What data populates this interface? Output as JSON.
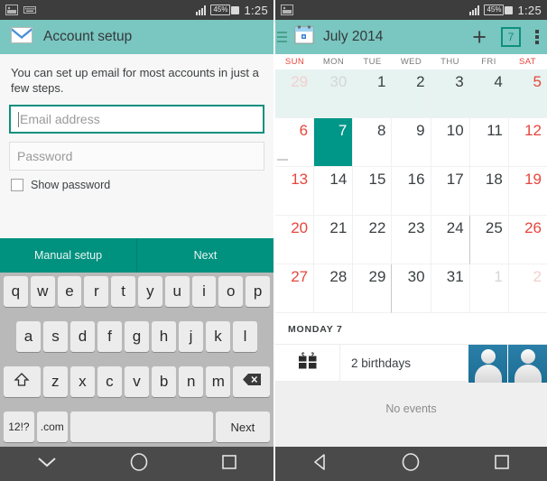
{
  "colors": {
    "header_teal": "#7ac6c0",
    "action_teal": "#00917f",
    "selected_teal": "#009688",
    "weekend_red": "#e8453c",
    "statusbar_gray": "#3d3d3d",
    "navbar_gray": "#4a4a4a",
    "keyboard_gray": "#b9b9b9",
    "key_face": "#ececec",
    "first_week_bg": "#e6f3f1",
    "avatar_blue": "#2a7fa8"
  },
  "left_panel": {
    "statusbar": {
      "icons": [
        "screenshot-icon",
        "keyboard-icon"
      ],
      "signal": "signal-icon",
      "battery_text": "45%",
      "battery_charging": true,
      "time": "1:25"
    },
    "header": {
      "icon": "email-envelope-icon",
      "title": "Account setup"
    },
    "body": {
      "intro": "You can set up email for most accounts in just a few steps.",
      "email_field": {
        "value": "",
        "placeholder": "Email address",
        "focused": true
      },
      "password_field": {
        "value": "",
        "placeholder": "Password",
        "focused": false
      },
      "show_password": {
        "label": "Show password",
        "checked": false
      }
    },
    "actionbar": {
      "manual_setup_label": "Manual setup",
      "next_label": "Next"
    },
    "keyboard": {
      "row1": [
        "q",
        "w",
        "e",
        "r",
        "t",
        "y",
        "u",
        "i",
        "o",
        "p"
      ],
      "row2": [
        "a",
        "s",
        "d",
        "f",
        "g",
        "h",
        "j",
        "k",
        "l"
      ],
      "row3_shift": "shift-icon",
      "row3": [
        "z",
        "x",
        "c",
        "v",
        "b",
        "n",
        "m"
      ],
      "row3_delete": "backspace-icon",
      "row4": {
        "symbols": "12!?",
        "dotcom": ".com",
        "space": "",
        "enter": "Next"
      }
    },
    "navbar": {
      "back": "hide-keyboard-chevron-icon",
      "home": "home-circle-icon",
      "recents": "recents-square-icon"
    }
  },
  "right_panel": {
    "statusbar": {
      "icons": [
        "screenshot-icon"
      ],
      "signal": "signal-icon",
      "battery_text": "45%",
      "battery_charging": true,
      "time": "1:25"
    },
    "header": {
      "menu": "hamburger-menu-icon",
      "app_icon": "calendar-icon",
      "title": "July 2014",
      "add": "plus-icon",
      "today_badge": "7",
      "overflow": "overflow-menu-icon"
    },
    "weekdays": [
      {
        "label": "SUN",
        "weekend": true
      },
      {
        "label": "MON",
        "weekend": false
      },
      {
        "label": "TUE",
        "weekend": false
      },
      {
        "label": "WED",
        "weekend": false
      },
      {
        "label": "THU",
        "weekend": false
      },
      {
        "label": "FRI",
        "weekend": false
      },
      {
        "label": "SAT",
        "weekend": true
      }
    ],
    "weeks": [
      [
        {
          "day": "29",
          "other": true,
          "sun": true,
          "sat": false,
          "selected": false,
          "divider": false,
          "dash": false
        },
        {
          "day": "30",
          "other": true,
          "sun": false,
          "sat": false,
          "selected": false,
          "divider": false,
          "dash": false
        },
        {
          "day": "1",
          "other": false,
          "sun": false,
          "sat": false,
          "selected": false,
          "divider": false,
          "dash": false
        },
        {
          "day": "2",
          "other": false,
          "sun": false,
          "sat": false,
          "selected": false,
          "divider": false,
          "dash": false
        },
        {
          "day": "3",
          "other": false,
          "sun": false,
          "sat": false,
          "selected": false,
          "divider": false,
          "dash": false
        },
        {
          "day": "4",
          "other": false,
          "sun": false,
          "sat": false,
          "selected": false,
          "divider": false,
          "dash": false
        },
        {
          "day": "5",
          "other": false,
          "sun": false,
          "sat": true,
          "selected": false,
          "divider": false,
          "dash": false
        }
      ],
      [
        {
          "day": "6",
          "other": false,
          "sun": true,
          "sat": false,
          "selected": false,
          "divider": false,
          "dash": true
        },
        {
          "day": "7",
          "other": false,
          "sun": false,
          "sat": false,
          "selected": true,
          "divider": false,
          "dash": false
        },
        {
          "day": "8",
          "other": false,
          "sun": false,
          "sat": false,
          "selected": false,
          "divider": false,
          "dash": false
        },
        {
          "day": "9",
          "other": false,
          "sun": false,
          "sat": false,
          "selected": false,
          "divider": false,
          "dash": false
        },
        {
          "day": "10",
          "other": false,
          "sun": false,
          "sat": false,
          "selected": false,
          "divider": false,
          "dash": false
        },
        {
          "day": "11",
          "other": false,
          "sun": false,
          "sat": false,
          "selected": false,
          "divider": false,
          "dash": false
        },
        {
          "day": "12",
          "other": false,
          "sun": false,
          "sat": true,
          "selected": false,
          "divider": false,
          "dash": false
        }
      ],
      [
        {
          "day": "13",
          "other": false,
          "sun": true,
          "sat": false,
          "selected": false,
          "divider": false,
          "dash": false
        },
        {
          "day": "14",
          "other": false,
          "sun": false,
          "sat": false,
          "selected": false,
          "divider": false,
          "dash": false
        },
        {
          "day": "15",
          "other": false,
          "sun": false,
          "sat": false,
          "selected": false,
          "divider": false,
          "dash": false
        },
        {
          "day": "16",
          "other": false,
          "sun": false,
          "sat": false,
          "selected": false,
          "divider": false,
          "dash": false
        },
        {
          "day": "17",
          "other": false,
          "sun": false,
          "sat": false,
          "selected": false,
          "divider": false,
          "dash": false
        },
        {
          "day": "18",
          "other": false,
          "sun": false,
          "sat": false,
          "selected": false,
          "divider": false,
          "dash": false
        },
        {
          "day": "19",
          "other": false,
          "sun": false,
          "sat": true,
          "selected": false,
          "divider": false,
          "dash": false
        }
      ],
      [
        {
          "day": "20",
          "other": false,
          "sun": true,
          "sat": false,
          "selected": false,
          "divider": false,
          "dash": false
        },
        {
          "day": "21",
          "other": false,
          "sun": false,
          "sat": false,
          "selected": false,
          "divider": false,
          "dash": false
        },
        {
          "day": "22",
          "other": false,
          "sun": false,
          "sat": false,
          "selected": false,
          "divider": false,
          "dash": false
        },
        {
          "day": "23",
          "other": false,
          "sun": false,
          "sat": false,
          "selected": false,
          "divider": false,
          "dash": false
        },
        {
          "day": "24",
          "other": false,
          "sun": false,
          "sat": false,
          "selected": false,
          "divider": true,
          "dash": false
        },
        {
          "day": "25",
          "other": false,
          "sun": false,
          "sat": false,
          "selected": false,
          "divider": false,
          "dash": false
        },
        {
          "day": "26",
          "other": false,
          "sun": false,
          "sat": true,
          "selected": false,
          "divider": false,
          "dash": false
        }
      ],
      [
        {
          "day": "27",
          "other": false,
          "sun": true,
          "sat": false,
          "selected": false,
          "divider": false,
          "dash": false
        },
        {
          "day": "28",
          "other": false,
          "sun": false,
          "sat": false,
          "selected": false,
          "divider": false,
          "dash": false
        },
        {
          "day": "29",
          "other": false,
          "sun": false,
          "sat": false,
          "selected": false,
          "divider": true,
          "dash": false
        },
        {
          "day": "30",
          "other": false,
          "sun": false,
          "sat": false,
          "selected": false,
          "divider": false,
          "dash": false
        },
        {
          "day": "31",
          "other": false,
          "sun": false,
          "sat": false,
          "selected": false,
          "divider": false,
          "dash": false
        },
        {
          "day": "1",
          "other": true,
          "sun": false,
          "sat": false,
          "selected": false,
          "divider": false,
          "dash": false
        },
        {
          "day": "2",
          "other": true,
          "sun": false,
          "sat": true,
          "selected": false,
          "divider": false,
          "dash": false
        }
      ]
    ],
    "events": {
      "day_label": "MONDAY 7",
      "row": {
        "icon": "gift-icon",
        "label": "2 birthdays",
        "avatar_count": 2
      },
      "empty_text": "No events"
    },
    "navbar": {
      "back": "back-triangle-icon",
      "home": "home-circle-icon",
      "recents": "recents-square-icon"
    }
  }
}
